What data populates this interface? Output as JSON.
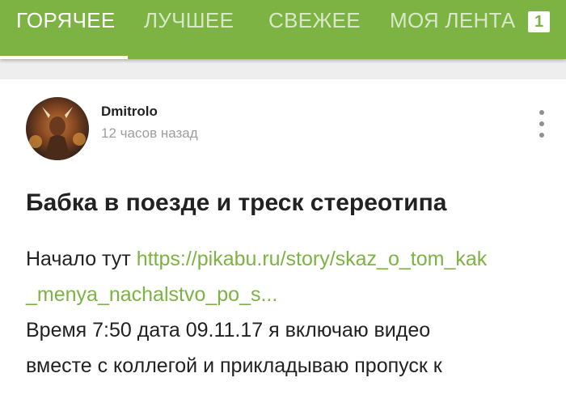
{
  "tabs": {
    "hot": "ГОРЯЧЕЕ",
    "best": "ЛУЧШЕЕ",
    "fresh": "СВЕЖЕЕ",
    "feed": "МОЯ ЛЕНТА",
    "feed_badge": "1"
  },
  "post": {
    "author": "Dmitrolo",
    "time": "12 часов назад",
    "title": "Бабка в поезде и треск стереотипа",
    "intro": "Начало тут",
    "link_line1": "https://pikabu.ru/story/skaz_o_tom_kak",
    "link_line2": "_menya_nachalstvo_po_s...",
    "text_line1": "Время 7:50 дата 09.11.17 я включаю видео",
    "text_line2": "вместе с коллегой и прикладываю пропуск к"
  },
  "icons": {
    "more": "more-vertical-icon",
    "avatar": "avatar-image"
  },
  "colors": {
    "accent": "#7cb342",
    "text": "#222222",
    "muted": "#9e9e9e"
  }
}
